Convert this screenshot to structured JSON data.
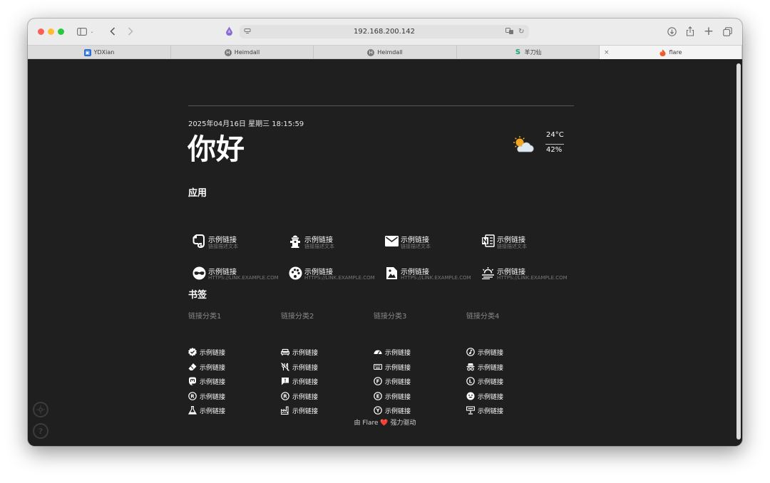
{
  "browser": {
    "address": "192.168.200.142",
    "tabs": [
      {
        "label": "YDXian"
      },
      {
        "label": "Heimdall"
      },
      {
        "label": "Heimdall"
      },
      {
        "label": "羊刀仙"
      },
      {
        "label": "flare"
      }
    ]
  },
  "page": {
    "datetime": "2025年04月16日 星期三 18:15:59",
    "greeting": "你好",
    "weather": {
      "temperature": "24°C",
      "humidity": "42%",
      "icon": "partly-cloudy-icon"
    },
    "apps_title": "应用",
    "apps": [
      {
        "name": "示例链接",
        "desc": "链接描述文本",
        "icon": "evernote-icon"
      },
      {
        "name": "示例链接",
        "desc": "链接描述文本",
        "icon": "fire-hydrant-icon"
      },
      {
        "name": "示例链接",
        "desc": "链接描述文本",
        "icon": "email-icon"
      },
      {
        "name": "示例链接",
        "desc": "链接描述文本",
        "icon": "onenote-icon"
      },
      {
        "name": "示例链接",
        "desc": "HTTPS://LINK.EXAMPLE.COM",
        "icon": "incognito-icon"
      },
      {
        "name": "示例链接",
        "desc": "HTTPS://LINK.EXAMPLE.COM",
        "icon": "palette-icon"
      },
      {
        "name": "示例链接",
        "desc": "HTTPS://LINK.EXAMPLE.COM",
        "icon": "image-edit-icon"
      },
      {
        "name": "示例链接",
        "desc": "HTTPS://LINK.EXAMPLE.COM",
        "icon": "weather-hazy-icon"
      }
    ],
    "bookmarks_title": "书签",
    "bookmark_categories": [
      {
        "title": "链接分类1",
        "items": [
          {
            "label": "示例链接",
            "icon": "check-decagram-icon"
          },
          {
            "label": "示例链接",
            "icon": "eraser-icon"
          },
          {
            "label": "示例链接",
            "icon": "mastodon-icon"
          },
          {
            "label": "示例链接",
            "icon": "letter-r-circle-icon"
          },
          {
            "label": "示例链接",
            "icon": "flask-icon"
          }
        ]
      },
      {
        "title": "链接分类2",
        "items": [
          {
            "label": "示例链接",
            "icon": "sofa-icon"
          },
          {
            "label": "示例链接",
            "icon": "no-food-icon"
          },
          {
            "label": "示例链接",
            "icon": "chat-alert-icon"
          },
          {
            "label": "示例链接",
            "icon": "letter-r-circle-icon"
          },
          {
            "label": "示例链接",
            "icon": "factory-icon"
          }
        ]
      },
      {
        "title": "链接分类3",
        "items": [
          {
            "label": "示例链接",
            "icon": "gauge-icon"
          },
          {
            "label": "示例链接",
            "icon": "keyboard-icon"
          },
          {
            "label": "示例链接",
            "icon": "letter-f-circle-icon"
          },
          {
            "label": "示例链接",
            "icon": "letter-e-circle-icon"
          },
          {
            "label": "示例链接",
            "icon": "letter-y-circle-icon"
          }
        ]
      },
      {
        "title": "链接分类4",
        "items": [
          {
            "label": "示例链接",
            "icon": "music-circle-icon"
          },
          {
            "label": "示例链接",
            "icon": "incognito-icon"
          },
          {
            "label": "示例链接",
            "icon": "letter-l-circle-icon"
          },
          {
            "label": "示例链接",
            "icon": "emoticon-icon"
          },
          {
            "label": "示例链接",
            "icon": "desk-lamp-icon"
          }
        ]
      }
    ],
    "footer": {
      "prefix": "由 Flare",
      "heart": "❤️",
      "suffix": "强力驱动"
    },
    "side": {
      "help": "?"
    }
  }
}
